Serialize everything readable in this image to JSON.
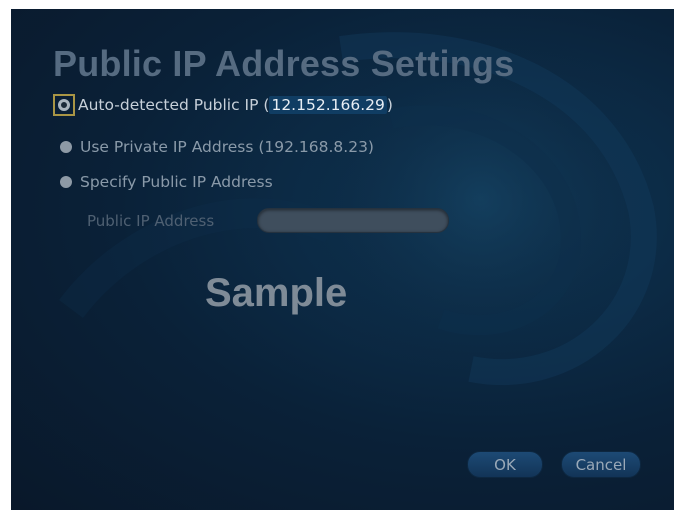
{
  "dialog": {
    "title": "Public IP Address Settings",
    "options": [
      {
        "label_prefix": "Auto-detected Public IP (",
        "ip": "12.152.166.29",
        "label_suffix": ")",
        "selected": true
      },
      {
        "label": "Use Private IP Address (192.168.8.23)",
        "selected": false
      },
      {
        "label": "Specify Public IP Address",
        "selected": false
      }
    ],
    "public_ip_field": {
      "label": "Public IP Address",
      "value": ""
    },
    "watermark": "Sample",
    "buttons": {
      "ok": "OK",
      "cancel": "Cancel"
    }
  }
}
